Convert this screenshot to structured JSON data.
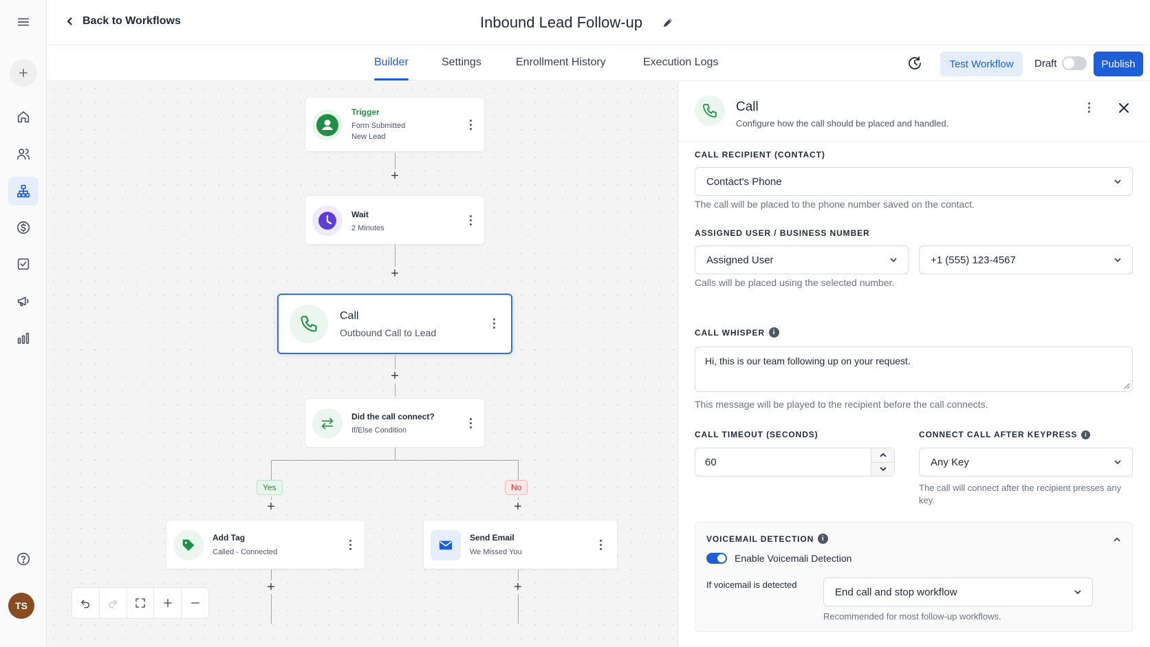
{
  "colors": {
    "accent": "#1d5fd6",
    "success": "#1f8f45",
    "danger": "#c53030",
    "wait_purple": "#5b3fd6"
  },
  "header": {
    "back_label": "Back to Workflows",
    "workflow_title": "Inbound Lead Follow-up"
  },
  "tabs": [
    {
      "label": "Builder",
      "active": true
    },
    {
      "label": "Settings",
      "active": false
    },
    {
      "label": "Enrollment History",
      "active": false
    },
    {
      "label": "Execution Logs",
      "active": false
    }
  ],
  "toolbar": {
    "test_label": "Test Workflow",
    "draft_label": "Draft",
    "draft_on": false,
    "publish_label": "Publish"
  },
  "user": {
    "initials": "TS"
  },
  "nodes": {
    "trigger": {
      "title": "Trigger",
      "sub1": "Form Submitted",
      "sub2": "New Lead"
    },
    "wait": {
      "title": "Wait",
      "sub": "2 Minutes"
    },
    "call": {
      "title": "Call",
      "sub": "Outbound Call to Lead"
    },
    "condition": {
      "title": "Did the call connect?",
      "sub": "If/Else Condition"
    },
    "yes_label": "Yes",
    "no_label": "No",
    "add_tag": {
      "title": "Add Tag",
      "sub": "Called - Connected"
    },
    "send_email": {
      "title": "Send Email",
      "sub": "We Missed You"
    }
  },
  "panel": {
    "title": "Call",
    "subtitle": "Configure how the call should be placed and handled.",
    "recipient_label": "CALL RECIPIENT (CONTACT)",
    "recipient_value": "Contact's Phone",
    "recipient_help": "The call will be placed to the phone number saved on the contact.",
    "assigned_label": "ASSIGNED USER / BUSINESS NUMBER",
    "assigned_user_value": "Assigned User",
    "business_number_value": "+1 (555) 123-4567",
    "assigned_help": "Calls will be placed using the selected number.",
    "whisper_label": "CALL WHISPER",
    "whisper_value": "Hi, this is our team following up on your request.",
    "whisper_help": "This message will be played to the recipient before the call connects.",
    "timeout_label": "CALL TIMEOUT (SECONDS)",
    "timeout_value": "60",
    "keypress_label": "CONNECT CALL AFTER KEYPRESS",
    "keypress_value": "Any Key",
    "keypress_help": "The call will connect after the recipient presses any key.",
    "voicemail_label": "VOICEMAIL DETECTION",
    "voicemail_toggle_label": "Enable Voicemali Detection",
    "voicemail_enabled": true,
    "voicemail_if_label": "If voicemail is detected",
    "voicemail_action_value": "End call and stop workflow",
    "voicemail_help": "Recommended for most follow-up workflows."
  }
}
